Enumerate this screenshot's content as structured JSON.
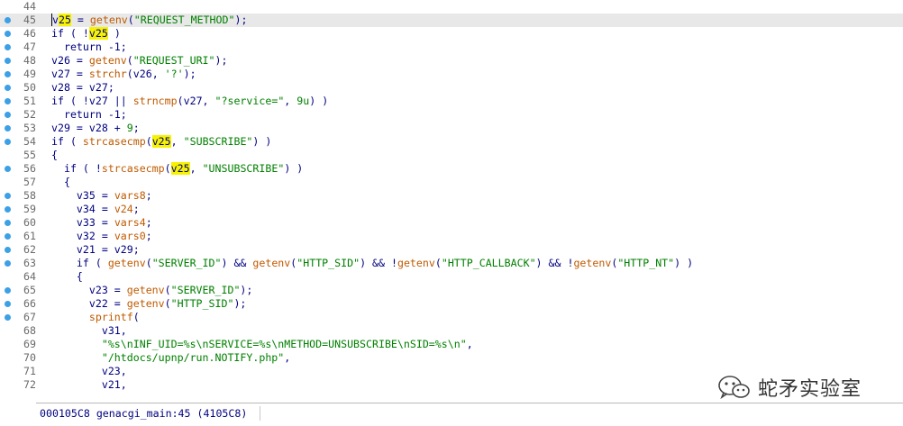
{
  "lines": [
    {
      "num": "44",
      "bp": false,
      "tokens": []
    },
    {
      "num": "45",
      "bp": true,
      "current": true,
      "tokens": [
        {
          "t": "v",
          "c": "var",
          "caret": true
        },
        {
          "t": "25",
          "c": "var hl"
        },
        {
          "t": " = "
        },
        {
          "t": "getenv",
          "c": "fn"
        },
        {
          "t": "("
        },
        {
          "t": "\"REQUEST_METHOD\"",
          "c": "str"
        },
        {
          "t": ");"
        }
      ]
    },
    {
      "num": "46",
      "bp": true,
      "tokens": [
        {
          "t": "if ( !"
        },
        {
          "t": "v25",
          "c": "hl"
        },
        {
          "t": " )"
        }
      ]
    },
    {
      "num": "47",
      "bp": true,
      "tokens": [
        {
          "t": "  return -1;"
        }
      ]
    },
    {
      "num": "48",
      "bp": true,
      "tokens": [
        {
          "t": "v26 = "
        },
        {
          "t": "getenv",
          "c": "fn"
        },
        {
          "t": "("
        },
        {
          "t": "\"REQUEST_URI\"",
          "c": "str"
        },
        {
          "t": ");"
        }
      ]
    },
    {
      "num": "49",
      "bp": true,
      "tokens": [
        {
          "t": "v27 = "
        },
        {
          "t": "strchr",
          "c": "fn"
        },
        {
          "t": "(v26, "
        },
        {
          "t": "'?'",
          "c": "str"
        },
        {
          "t": ");"
        }
      ]
    },
    {
      "num": "50",
      "bp": true,
      "tokens": [
        {
          "t": "v28 = v27;"
        }
      ]
    },
    {
      "num": "51",
      "bp": true,
      "tokens": [
        {
          "t": "if ( !v27 || "
        },
        {
          "t": "strncmp",
          "c": "fn"
        },
        {
          "t": "(v27, "
        },
        {
          "t": "\"?service=\"",
          "c": "str"
        },
        {
          "t": ", "
        },
        {
          "t": "9u",
          "c": "num"
        },
        {
          "t": ") )"
        }
      ]
    },
    {
      "num": "52",
      "bp": true,
      "tokens": [
        {
          "t": "  return -1;"
        }
      ]
    },
    {
      "num": "53",
      "bp": true,
      "tokens": [
        {
          "t": "v29 = v28 + "
        },
        {
          "t": "9",
          "c": "num"
        },
        {
          "t": ";"
        }
      ]
    },
    {
      "num": "54",
      "bp": true,
      "tokens": [
        {
          "t": "if ( "
        },
        {
          "t": "strcasecmp",
          "c": "fn"
        },
        {
          "t": "("
        },
        {
          "t": "v25",
          "c": "hl"
        },
        {
          "t": ", "
        },
        {
          "t": "\"SUBSCRIBE\"",
          "c": "str"
        },
        {
          "t": ") )"
        }
      ]
    },
    {
      "num": "55",
      "bp": false,
      "tokens": [
        {
          "t": "{"
        }
      ]
    },
    {
      "num": "56",
      "bp": true,
      "tokens": [
        {
          "t": "  if ( !"
        },
        {
          "t": "strcasecmp",
          "c": "fn"
        },
        {
          "t": "("
        },
        {
          "t": "v25",
          "c": "hl"
        },
        {
          "t": ", "
        },
        {
          "t": "\"UNSUBSCRIBE\"",
          "c": "str"
        },
        {
          "t": ") )"
        }
      ]
    },
    {
      "num": "57",
      "bp": false,
      "tokens": [
        {
          "t": "  {"
        }
      ]
    },
    {
      "num": "58",
      "bp": true,
      "tokens": [
        {
          "t": "    v35 = "
        },
        {
          "t": "vars8",
          "c": "fn"
        },
        {
          "t": ";"
        }
      ]
    },
    {
      "num": "59",
      "bp": true,
      "tokens": [
        {
          "t": "    v34 = "
        },
        {
          "t": "v24",
          "c": "gv"
        },
        {
          "t": ";"
        }
      ]
    },
    {
      "num": "60",
      "bp": true,
      "tokens": [
        {
          "t": "    v33 = "
        },
        {
          "t": "vars4",
          "c": "fn"
        },
        {
          "t": ";"
        }
      ]
    },
    {
      "num": "61",
      "bp": true,
      "tokens": [
        {
          "t": "    v32 = "
        },
        {
          "t": "vars0",
          "c": "fn"
        },
        {
          "t": ";"
        }
      ]
    },
    {
      "num": "62",
      "bp": true,
      "tokens": [
        {
          "t": "    v21 = v29;"
        }
      ]
    },
    {
      "num": "63",
      "bp": true,
      "tokens": [
        {
          "t": "    if ( "
        },
        {
          "t": "getenv",
          "c": "fn"
        },
        {
          "t": "("
        },
        {
          "t": "\"SERVER_ID\"",
          "c": "str"
        },
        {
          "t": ") && "
        },
        {
          "t": "getenv",
          "c": "fn"
        },
        {
          "t": "("
        },
        {
          "t": "\"HTTP_SID\"",
          "c": "str"
        },
        {
          "t": ") && !"
        },
        {
          "t": "getenv",
          "c": "fn"
        },
        {
          "t": "("
        },
        {
          "t": "\"HTTP_CALLBACK\"",
          "c": "str"
        },
        {
          "t": ") && !"
        },
        {
          "t": "getenv",
          "c": "fn"
        },
        {
          "t": "("
        },
        {
          "t": "\"HTTP_NT\"",
          "c": "str"
        },
        {
          "t": ") )"
        }
      ]
    },
    {
      "num": "64",
      "bp": false,
      "tokens": [
        {
          "t": "    {"
        }
      ]
    },
    {
      "num": "65",
      "bp": true,
      "tokens": [
        {
          "t": "      v23 = "
        },
        {
          "t": "getenv",
          "c": "fn"
        },
        {
          "t": "("
        },
        {
          "t": "\"SERVER_ID\"",
          "c": "str"
        },
        {
          "t": ");"
        }
      ]
    },
    {
      "num": "66",
      "bp": true,
      "tokens": [
        {
          "t": "      v22 = "
        },
        {
          "t": "getenv",
          "c": "fn"
        },
        {
          "t": "("
        },
        {
          "t": "\"HTTP_SID\"",
          "c": "str"
        },
        {
          "t": ");"
        }
      ]
    },
    {
      "num": "67",
      "bp": true,
      "tokens": [
        {
          "t": "      "
        },
        {
          "t": "sprintf",
          "c": "fn"
        },
        {
          "t": "("
        }
      ]
    },
    {
      "num": "68",
      "bp": false,
      "tokens": [
        {
          "t": "        v31,"
        }
      ]
    },
    {
      "num": "69",
      "bp": false,
      "tokens": [
        {
          "t": "        "
        },
        {
          "t": "\"%s\\nINF_UID=%s\\nSERVICE=%s\\nMETHOD=UNSUBSCRIBE\\nSID=%s\\n\"",
          "c": "str"
        },
        {
          "t": ","
        }
      ]
    },
    {
      "num": "70",
      "bp": false,
      "tokens": [
        {
          "t": "        "
        },
        {
          "t": "\"/htdocs/upnp/run.NOTIFY.php\"",
          "c": "str"
        },
        {
          "t": ","
        }
      ]
    },
    {
      "num": "71",
      "bp": false,
      "tokens": [
        {
          "t": "        v23,"
        }
      ]
    },
    {
      "num": "72",
      "bp": false,
      "tokens": [
        {
          "t": "        v21,"
        }
      ]
    }
  ],
  "status": {
    "text": "000105C8 genacgi_main:45 (4105C8)"
  },
  "watermark": {
    "text": "蛇矛实验室",
    "icon": "wechat-logo-icon"
  },
  "colors": {
    "keyword": "#000080",
    "function": "#c05a00",
    "string": "#008000",
    "highlight": "#f7f300",
    "breakpoint": "#3ca0e6",
    "current_line": "#e8e8e8"
  }
}
